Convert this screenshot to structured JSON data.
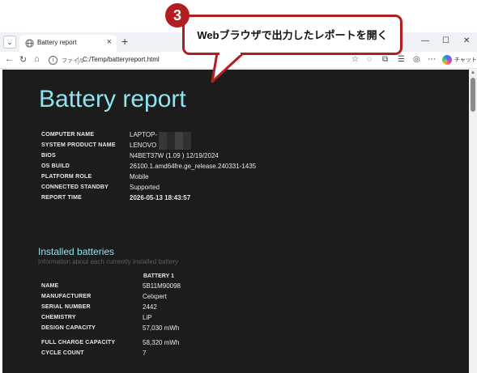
{
  "browser": {
    "tab_title": "Battery report",
    "tab_close": "×",
    "new_tab": "+",
    "minimize": "—",
    "maximize": "☐",
    "close": "✕",
    "url_scheme_label": "ファイル",
    "url": "C:/Temp/batteryreport.html",
    "copilot_label": "チャット"
  },
  "callout": {
    "step": "3",
    "text": "Webブラウザで出力したレポートを開く"
  },
  "report": {
    "title": "Battery report",
    "system": [
      {
        "label": "COMPUTER NAME",
        "value": "LAPTOP-"
      },
      {
        "label": "SYSTEM PRODUCT NAME",
        "value": "LENOVO"
      },
      {
        "label": "BIOS",
        "value": "N4BET37W (1.09 ) 12/19/2024"
      },
      {
        "label": "OS BUILD",
        "value": "26100.1.amd64fre.ge_release.240331-1435"
      },
      {
        "label": "PLATFORM ROLE",
        "value": "Mobile"
      },
      {
        "label": "CONNECTED STANDBY",
        "value": "Supported"
      },
      {
        "label": "REPORT TIME",
        "value": "2026-05-13  18:43:57"
      }
    ],
    "installed": {
      "title": "Installed batteries",
      "subtitle": "Information about each currently installed battery",
      "column": "BATTERY 1",
      "rows": [
        {
          "label": "NAME",
          "value": "5B11M90098"
        },
        {
          "label": "MANUFACTURER",
          "value": "Celxpert"
        },
        {
          "label": "SERIAL NUMBER",
          "value": "2442"
        },
        {
          "label": "CHEMISTRY",
          "value": "LiP"
        },
        {
          "label": "DESIGN CAPACITY",
          "value": "57,030 mWh"
        },
        {
          "label": "FULL CHARGE CAPACITY",
          "value": "58,320 mWh"
        },
        {
          "label": "CYCLE COUNT",
          "value": "7"
        }
      ]
    }
  },
  "colors": {
    "accent": "#8fe3ef",
    "page_bg": "#1c1c1c",
    "callout_border": "#b21d20"
  }
}
